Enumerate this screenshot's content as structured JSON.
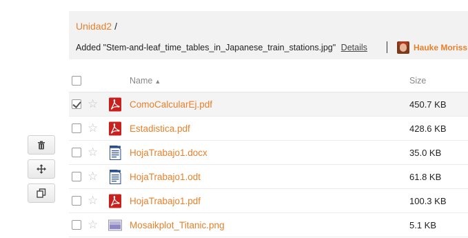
{
  "breadcrumb": {
    "folder": "Unidad2",
    "separator": "/"
  },
  "activity": {
    "message": "Added \"Stem-and-leaf_time_tables_in_Japanese_train_stations.jpg\"",
    "details_link": "Details",
    "user_name": "Hauke Moriss"
  },
  "table": {
    "headers": {
      "name": "Name",
      "sort_arrow": "▲",
      "size": "Size"
    },
    "rows": [
      {
        "name": "ComoCalcularEj.pdf",
        "size": "450.7 KB",
        "type": "pdf",
        "selected": true
      },
      {
        "name": "Estadistica.pdf",
        "size": "428.6 KB",
        "type": "pdf",
        "selected": false
      },
      {
        "name": "HojaTrabajo1.docx",
        "size": "35.0 KB",
        "type": "doc",
        "selected": false
      },
      {
        "name": "HojaTrabajo1.odt",
        "size": "61.8 KB",
        "type": "doc",
        "selected": false
      },
      {
        "name": "HojaTrabajo1.pdf",
        "size": "100.3 KB",
        "type": "pdf",
        "selected": false
      },
      {
        "name": "Mosaikplot_Titanic.png",
        "size": "5.1 KB",
        "type": "image",
        "selected": false
      }
    ]
  },
  "side_actions": [
    "trash-icon",
    "move-icon",
    "copy-icon"
  ],
  "colors": {
    "accent": "#e8802a",
    "pdf_red": "#c8201c",
    "doc_blue": "#2b4f8c"
  }
}
